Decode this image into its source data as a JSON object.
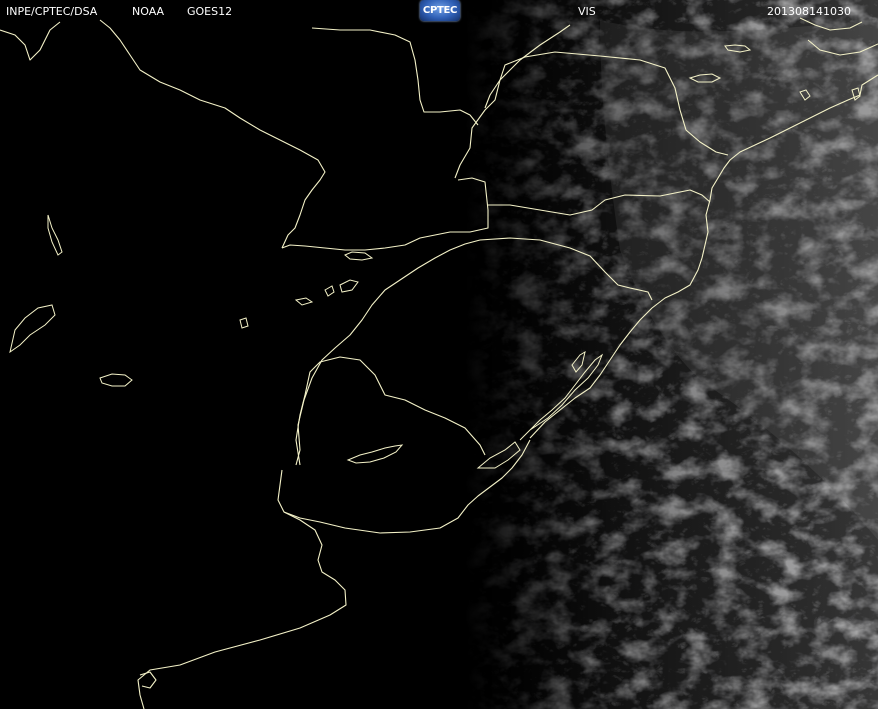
{
  "header": {
    "agency": "INPE/CPTEC/DSA",
    "provider": "NOAA",
    "satellite": "GOES12",
    "logo_text": "CPTEC",
    "channel": "VIS",
    "timestamp": "201308141030"
  },
  "colors": {
    "background": "#000000",
    "header_text": "#ffffff",
    "borders": "#f4f2c8",
    "logo": "#2f5fb5"
  },
  "icons": {
    "logo": "cptec-logo-icon"
  }
}
